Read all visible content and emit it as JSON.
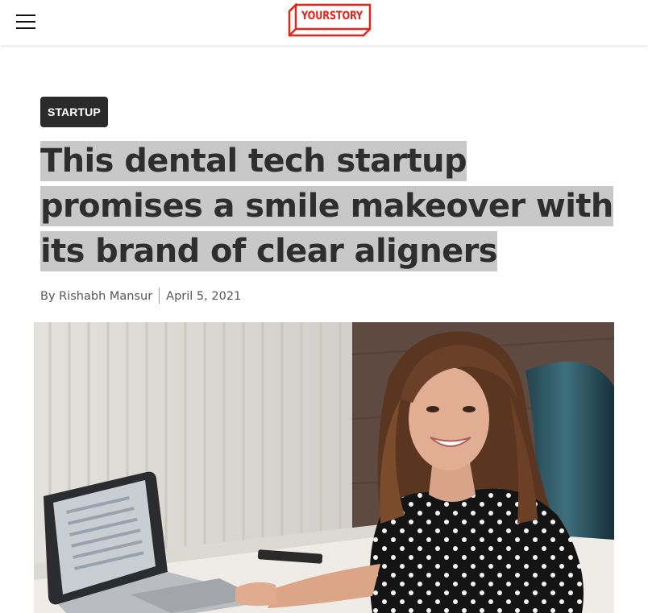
{
  "header": {
    "menu_icon": "hamburger-menu-icon",
    "logo_text": "YOURSTORY",
    "logo_color": "#e1251b"
  },
  "article": {
    "category": "STARTUP",
    "title": "This dental tech startup promises a smile makeover with its brand of clear aligners",
    "byline": {
      "author": "By Rishabh Mansur",
      "date": "April 5, 2021"
    },
    "hero_image": "smiling-woman-at-laptop-photo"
  }
}
